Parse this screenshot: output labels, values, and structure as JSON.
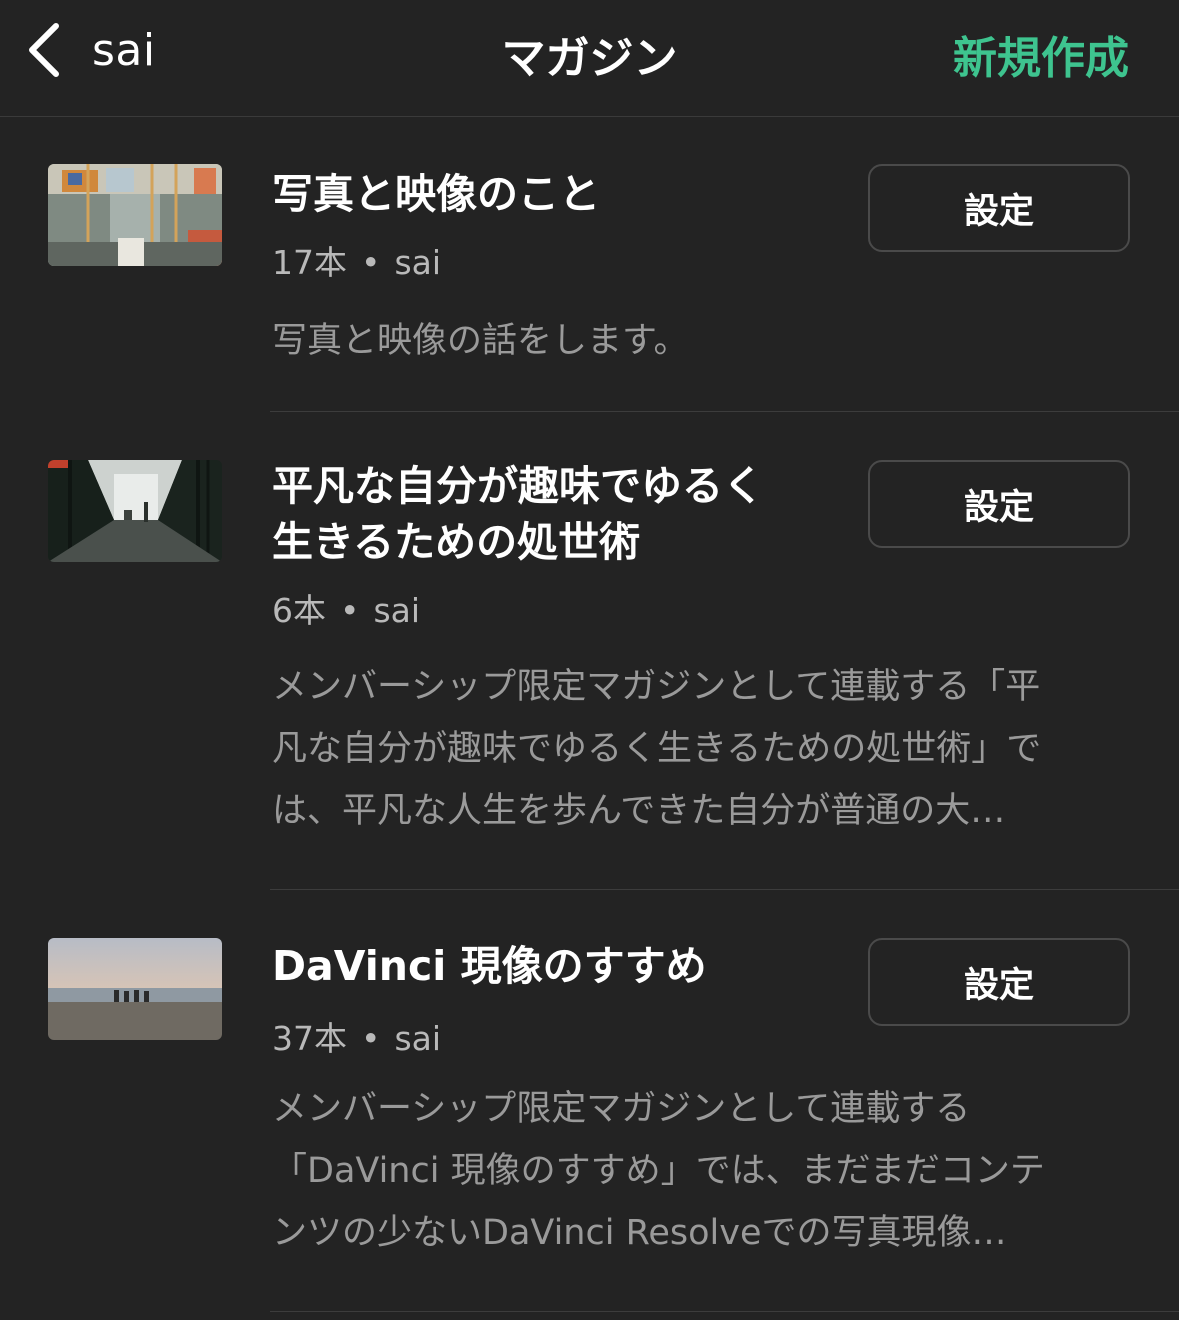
{
  "nav": {
    "back_label": "sai",
    "title": "マガジン",
    "new_label": "新規作成",
    "accent_color": "#3ec48f"
  },
  "magazines": [
    {
      "title": "写真と映像のこと",
      "count": "17本",
      "author": "sai",
      "description": "写真と映像の話をします。",
      "settings_label": "設定",
      "thumbnail_icon": "train-interior-photo"
    },
    {
      "title": "平凡な自分が趣味でゆるく\n生きるための処世術",
      "count": "6本",
      "author": "sai",
      "description": "メンバーシップ限定マガジンとして連載する「平\n凡な自分が趣味でゆるく生きるための処世術」で\nは、平凡な人生を歩んできた自分が普通の大…",
      "settings_label": "設定",
      "thumbnail_icon": "corridor-photo"
    },
    {
      "title": "DaVinci 現像のすすめ",
      "count": "37本",
      "author": "sai",
      "description": "メンバーシップ限定マガジンとして連載する\n「DaVinci 現像のすすめ」では、まだまだコンテ\nンツの少ないDaVinci Resolveでの写真現像…",
      "settings_label": "設定",
      "thumbnail_icon": "beach-photo"
    }
  ]
}
